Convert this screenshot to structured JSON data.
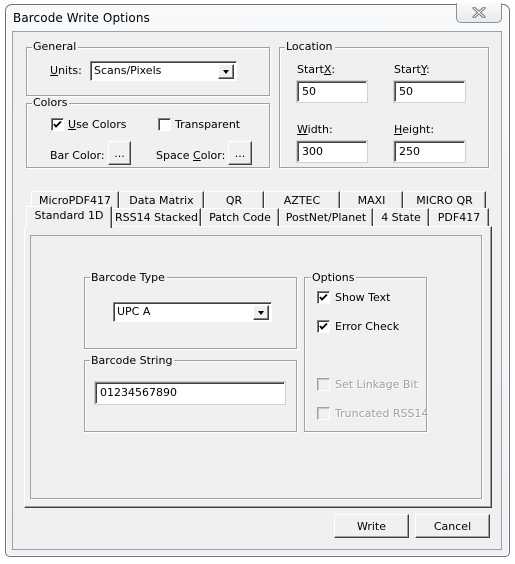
{
  "window": {
    "title": "Barcode Write Options",
    "close_icon": "close-x-icon"
  },
  "general": {
    "label": "General",
    "units_label_u": "U",
    "units_label_rest": "nits:",
    "units_value": "Scans/Pixels"
  },
  "colors": {
    "label": "Colors",
    "use_colors_u": "U",
    "use_colors_rest": "se Colors",
    "use_colors_checked": true,
    "transparent_label": "Transparent",
    "transparent_checked": false,
    "bar_color_label": "Bar Color:",
    "bar_color_button": "...",
    "space_color_pre": "Space ",
    "space_color_u": "C",
    "space_color_rest": "olor:",
    "space_color_button": "..."
  },
  "location": {
    "label": "Location",
    "startx_pre": "Start",
    "startx_u": "X",
    "startx_post": ":",
    "startx_value": "50",
    "starty_pre": "Start",
    "starty_u": "Y",
    "starty_post": ":",
    "starty_value": "50",
    "width_u": "W",
    "width_rest": "idth:",
    "width_value": "300",
    "height_u": "H",
    "height_rest": "eight:",
    "height_value": "250"
  },
  "tabs": {
    "row_back": [
      "MicroPDF417",
      "Data Matrix",
      "QR",
      "AZTEC",
      "MAXI",
      "MICRO QR"
    ],
    "row_front": [
      "Standard 1D",
      "RSS14 Stacked",
      "Patch Code",
      "PostNet/Planet",
      "4 State",
      "PDF417"
    ],
    "active": "Standard 1D"
  },
  "standard1d": {
    "barcode_type_label": "Barcode Type",
    "barcode_type_value": "UPC A",
    "barcode_string_label": "Barcode String",
    "barcode_string_value": "01234567890",
    "options_label": "Options",
    "show_text_label": "Show Text",
    "show_text_checked": true,
    "error_check_label": "Error Check",
    "error_check_checked": true,
    "set_linkage_bit_label": "Set Linkage Bit",
    "set_linkage_bit_enabled": false,
    "truncated_rss14_label": "Truncated RSS14",
    "truncated_rss14_enabled": false
  },
  "buttons": {
    "write": "Write",
    "cancel": "Cancel"
  }
}
